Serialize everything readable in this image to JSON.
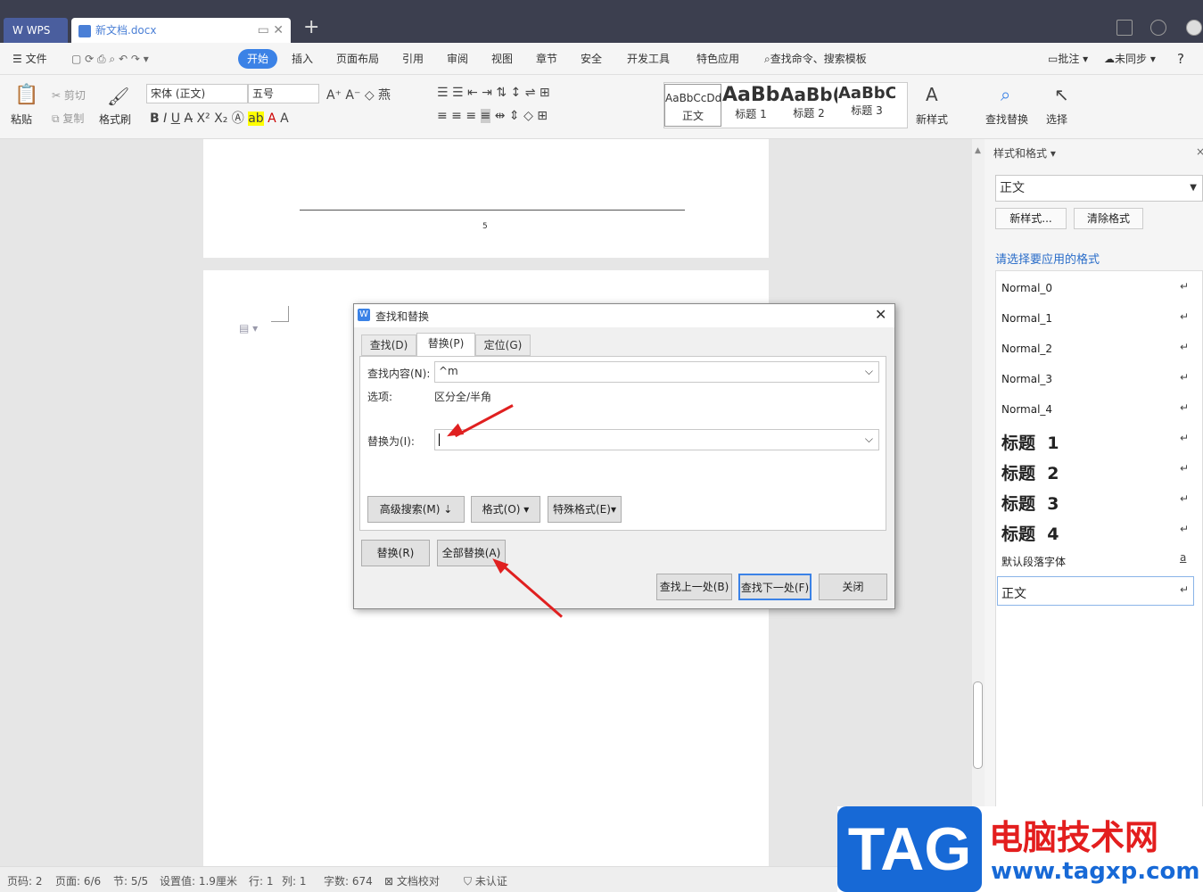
{
  "titlebar": {
    "app_label": "WPS",
    "doc_tab": "新文档.docx",
    "add": "+"
  },
  "menu": {
    "file": "文件",
    "start": "开始",
    "insert": "插入",
    "layout": "页面布局",
    "ref": "引用",
    "review": "审阅",
    "view": "视图",
    "chapter": "章节",
    "security": "安全",
    "devtools": "开发工具",
    "special": "特色应用",
    "search": "查找命令、搜索模板",
    "annot": "批注",
    "sync": "未同步",
    "help": "?"
  },
  "ribbon": {
    "paste": "粘贴",
    "cut": "剪切",
    "copy": "复制",
    "format_painter": "格式刷",
    "font": "宋体 (正文)",
    "size": "五号",
    "styles": [
      {
        "sample": "AaBbCcDd",
        "name": "正文"
      },
      {
        "sample": "AaBb",
        "name": "标题 1"
      },
      {
        "sample": "AaBb(",
        "name": "标题 2"
      },
      {
        "sample": "AaBbC(",
        "name": "标题 3"
      }
    ],
    "new_style": "新样式",
    "find_replace": "查找替换",
    "select": "选择"
  },
  "page": {
    "page_number": "5"
  },
  "panel": {
    "title": "样式和格式",
    "current_style": "正文",
    "new_style_btn": "新样式...",
    "clear_btn": "清除格式",
    "hint": "请选择要应用的格式",
    "items": [
      "Normal_0",
      "Normal_1",
      "Normal_2",
      "Normal_3",
      "Normal_4",
      "标题  1",
      "标题  2",
      "标题  3",
      "标题  4",
      "默认段落字体",
      "正文"
    ]
  },
  "status": {
    "page_code": "页码: 2",
    "pages": "页面: 6/6",
    "section": "节: 5/5",
    "setting": "设置值: 1.9厘米",
    "row": "行: 1",
    "col": "列: 1",
    "words": "字数: 674",
    "proof": "文档校对",
    "cert": "未认证"
  },
  "dialog": {
    "title": "查找和替换",
    "tabs": [
      "查找(D)",
      "替换(P)",
      "定位(G)"
    ],
    "find_label": "查找内容(N):",
    "find_value": "^m",
    "options_label": "选项:",
    "options_value": "区分全/半角",
    "replace_label": "替换为(I):",
    "replace_value": "",
    "advanced": "高级搜索(M)",
    "format": "格式(O)",
    "special_format": "特殊格式(E)",
    "replace_btn": "替换(R)",
    "replace_all": "全部替换(A)",
    "find_prev": "查找上一处(B)",
    "find_next": "查找下一处(F)",
    "close": "关闭"
  },
  "watermark": {
    "logo": "TAG",
    "site_name": "电脑技术网",
    "url": "www.tagxp.com"
  },
  "colors": {
    "accent": "#3b82e6",
    "arrow": "#e02020",
    "title_bg": "#3c3f4f"
  }
}
